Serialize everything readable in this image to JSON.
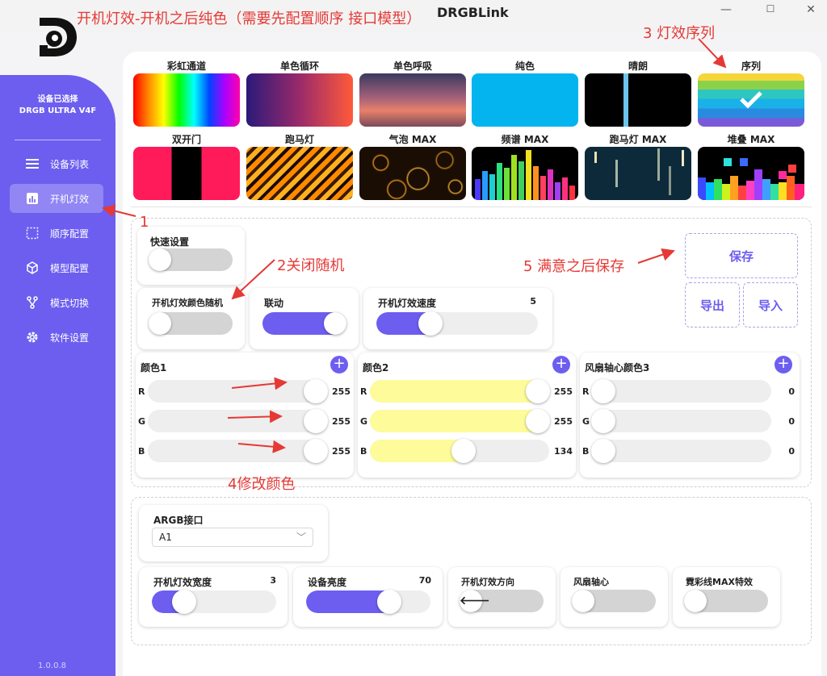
{
  "window": {
    "title": "DRGBLink",
    "minimize": "—",
    "maximize": "☐",
    "close": "✕"
  },
  "annotations": {
    "top": "开机灯效-开机之后纯色（需要先配置顺序 接口模型）",
    "a1": "1",
    "a2": "2关闭随机",
    "a3": "3 灯效序列",
    "a4": "4修改颜色",
    "a5": "5 满意之后保存"
  },
  "sidebar": {
    "status": "设备已选择",
    "device": "DRGB ULTRA V4F",
    "items": [
      {
        "label": "设备列表",
        "icon": "menu-icon"
      },
      {
        "label": "开机灯效",
        "icon": "chart-icon",
        "active": true
      },
      {
        "label": "顺序配置",
        "icon": "dashed-square-icon"
      },
      {
        "label": "模型配置",
        "icon": "cube-icon"
      },
      {
        "label": "模式切换",
        "icon": "switch-icon"
      },
      {
        "label": "软件设置",
        "icon": "gear-icon"
      }
    ],
    "version": "1.0.0.8"
  },
  "effects": [
    {
      "label": "彩虹通道"
    },
    {
      "label": "单色循环"
    },
    {
      "label": "单色呼吸"
    },
    {
      "label": "纯色"
    },
    {
      "label": "晴朗"
    },
    {
      "label": "序列",
      "selected": true
    },
    {
      "label": "双开门"
    },
    {
      "label": "跑马灯"
    },
    {
      "label": "气泡 MAX"
    },
    {
      "label": "频谱 MAX"
    },
    {
      "label": "跑马灯 MAX"
    },
    {
      "label": "堆叠 MAX"
    }
  ],
  "controls": {
    "quick_setup": {
      "label": "快速设置",
      "on": false
    },
    "random_color": {
      "label": "开机灯效颜色随机",
      "on": false
    },
    "link": {
      "label": "联动",
      "on": true
    },
    "speed": {
      "label": "开机灯效速度",
      "value": "5",
      "level": 0.3
    },
    "save": "保存",
    "export": "导出",
    "import": "导入"
  },
  "color_groups": [
    {
      "title": "颜色1",
      "rows": [
        {
          "ch": "R",
          "value": 255
        },
        {
          "ch": "G",
          "value": 255
        },
        {
          "ch": "B",
          "value": 255
        }
      ]
    },
    {
      "title": "颜色2",
      "rows": [
        {
          "ch": "R",
          "value": 255
        },
        {
          "ch": "G",
          "value": 255
        },
        {
          "ch": "B",
          "value": 134
        }
      ]
    },
    {
      "title": "风扇轴心颜色3",
      "rows": [
        {
          "ch": "R",
          "value": 0
        },
        {
          "ch": "G",
          "value": 0
        },
        {
          "ch": "B",
          "value": 0
        }
      ]
    }
  ],
  "colors": {
    "accent": "#6d5ef0",
    "color2_fill": "#fdfb9a"
  },
  "argb": {
    "label": "ARGB接口",
    "value": "A1"
  },
  "bottom": {
    "width": {
      "label": "开机灯效宽度",
      "value": "3",
      "level": 0.2
    },
    "brightness": {
      "label": "设备亮度",
      "value": "70",
      "level": 0.7
    },
    "direction": {
      "label": "开机灯效方向",
      "arrow": "🡐"
    },
    "fan_axis": {
      "label": "风扇轴心",
      "on": false
    },
    "neon_max": {
      "label": "霓彩线MAX特效",
      "on": false
    }
  }
}
